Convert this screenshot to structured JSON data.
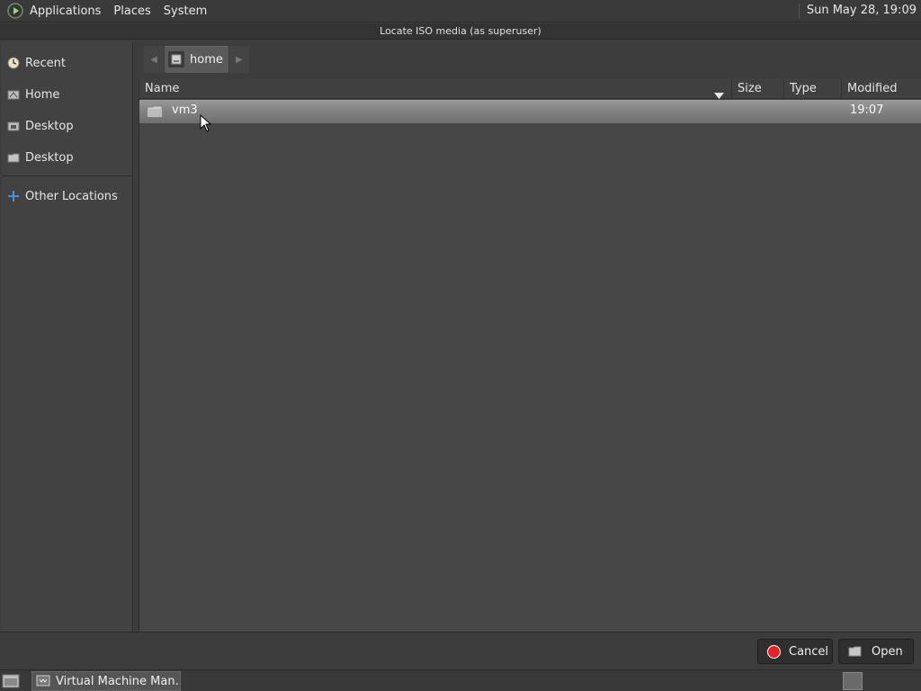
{
  "top_panel": {
    "menus": [
      "Applications",
      "Places",
      "System"
    ],
    "clock": "Sun May 28, 19:09"
  },
  "window": {
    "title": "Locate ISO media (as superuser)"
  },
  "sidebar": {
    "items": [
      {
        "label": "Recent",
        "icon": "clock-icon"
      },
      {
        "label": "Home",
        "icon": "home-icon"
      },
      {
        "label": "Desktop",
        "icon": "desktop-icon"
      },
      {
        "label": "Desktop",
        "icon": "folder-icon"
      },
      {
        "label": "Other Locations",
        "icon": "plus-icon"
      }
    ]
  },
  "pathbar": {
    "current": "home"
  },
  "columns": [
    "Name",
    "Size",
    "Type",
    "Modified"
  ],
  "files": [
    {
      "name": "vm3",
      "size": "",
      "type": "",
      "modified": "19:07"
    }
  ],
  "actions": {
    "cancel": "Cancel",
    "open": "Open"
  },
  "taskbar": {
    "task_label": "Virtual Machine Man…"
  },
  "colors": {
    "selection": "#8a8a8a",
    "cancel_red": "#e0242a"
  }
}
